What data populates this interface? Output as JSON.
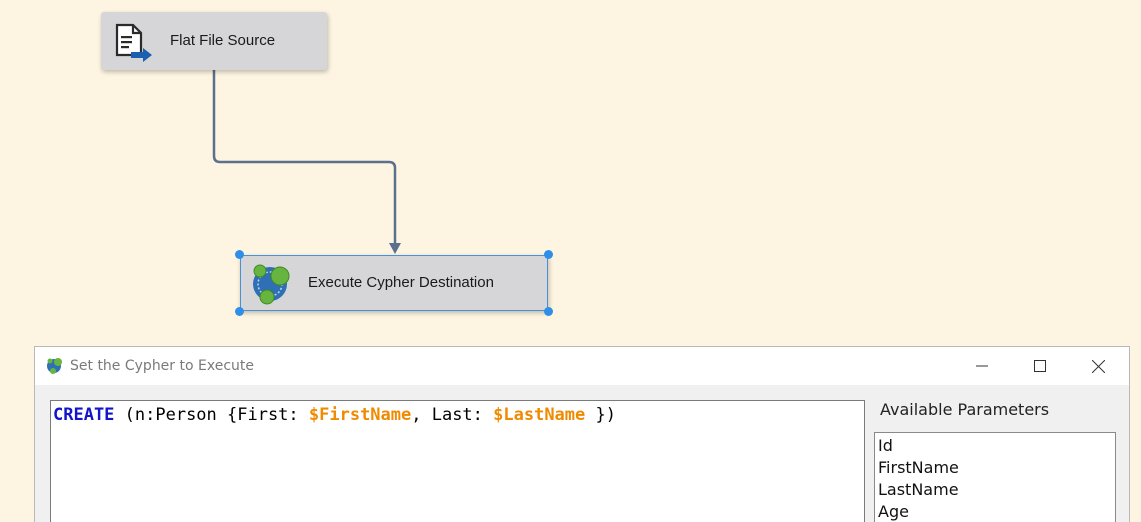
{
  "canvas": {
    "background": "#fdf5e1",
    "nodes": [
      {
        "label": "Flat File Source",
        "icon": "flat-file-source-icon"
      },
      {
        "label": "Execute Cypher Destination",
        "icon": "neo4j-cypher-icon",
        "selected": true
      }
    ],
    "selection_color": "#2f8fe8"
  },
  "dialog": {
    "title": "Set the Cypher to Execute",
    "icon": "neo4j-app-icon",
    "controls": [
      "minimize-icon",
      "maximize-icon",
      "close-icon"
    ],
    "editor": {
      "tokens": [
        {
          "text": "CREATE",
          "kind": "keyword"
        },
        {
          "text": " (n:Person {First: ",
          "kind": "plain"
        },
        {
          "text": "$FirstName",
          "kind": "param"
        },
        {
          "text": ", Last: ",
          "kind": "plain"
        },
        {
          "text": "$LastName",
          "kind": "param"
        },
        {
          "text": " })",
          "kind": "plain"
        }
      ],
      "colors": {
        "keyword": "#1414c8",
        "param": "#f08a00"
      }
    },
    "available_parameters": {
      "label": "Available Parameters",
      "items": [
        "Id",
        "FirstName",
        "LastName",
        "Age"
      ]
    }
  }
}
